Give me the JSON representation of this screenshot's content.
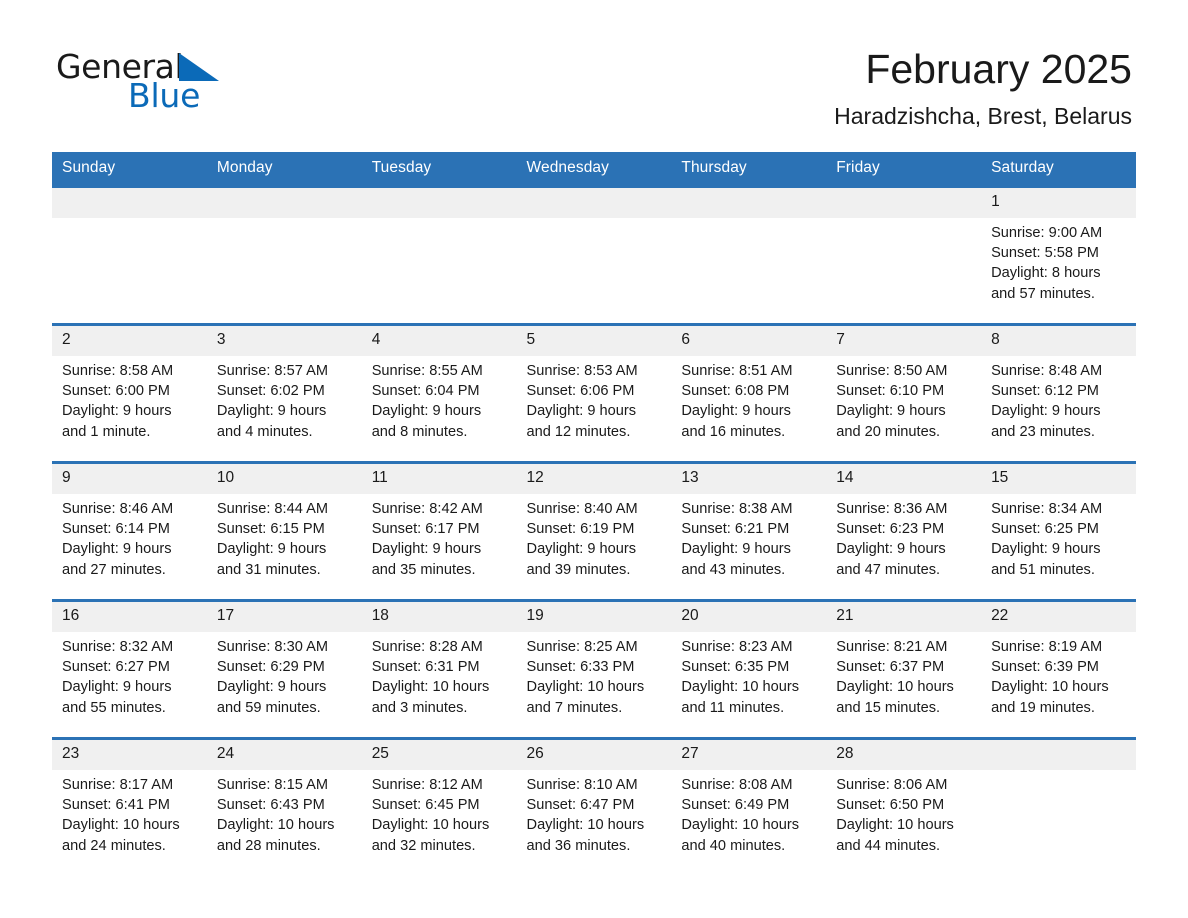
{
  "brand": {
    "name_part1": "General",
    "name_part2": "Blue",
    "accent_color": "#0b6ab8"
  },
  "header": {
    "title": "February 2025",
    "subtitle": "Haradzishcha, Brest, Belarus",
    "header_bg_color": "#2b72b5",
    "daynum_bg_color": "#f0f0f0"
  },
  "weekdays": [
    "Sunday",
    "Monday",
    "Tuesday",
    "Wednesday",
    "Thursday",
    "Friday",
    "Saturday"
  ],
  "labels": {
    "sunrise_prefix": "Sunrise:",
    "sunset_prefix": "Sunset:",
    "daylight_prefix": "Daylight:"
  },
  "weeks": [
    [
      {
        "day": "",
        "line1": "",
        "line2": "",
        "line3": "",
        "line4": "",
        "blank": true
      },
      {
        "day": "",
        "line1": "",
        "line2": "",
        "line3": "",
        "line4": "",
        "blank": true
      },
      {
        "day": "",
        "line1": "",
        "line2": "",
        "line3": "",
        "line4": "",
        "blank": true
      },
      {
        "day": "",
        "line1": "",
        "line2": "",
        "line3": "",
        "line4": "",
        "blank": true
      },
      {
        "day": "",
        "line1": "",
        "line2": "",
        "line3": "",
        "line4": "",
        "blank": true
      },
      {
        "day": "",
        "line1": "",
        "line2": "",
        "line3": "",
        "line4": "",
        "blank": true
      },
      {
        "day": "1",
        "line1": "Sunrise: 9:00 AM",
        "line2": "Sunset: 5:58 PM",
        "line3": "Daylight: 8 hours",
        "line4": "and 57 minutes.",
        "blank": false
      }
    ],
    [
      {
        "day": "2",
        "line1": "Sunrise: 8:58 AM",
        "line2": "Sunset: 6:00 PM",
        "line3": "Daylight: 9 hours",
        "line4": "and 1 minute.",
        "blank": false
      },
      {
        "day": "3",
        "line1": "Sunrise: 8:57 AM",
        "line2": "Sunset: 6:02 PM",
        "line3": "Daylight: 9 hours",
        "line4": "and 4 minutes.",
        "blank": false
      },
      {
        "day": "4",
        "line1": "Sunrise: 8:55 AM",
        "line2": "Sunset: 6:04 PM",
        "line3": "Daylight: 9 hours",
        "line4": "and 8 minutes.",
        "blank": false
      },
      {
        "day": "5",
        "line1": "Sunrise: 8:53 AM",
        "line2": "Sunset: 6:06 PM",
        "line3": "Daylight: 9 hours",
        "line4": "and 12 minutes.",
        "blank": false
      },
      {
        "day": "6",
        "line1": "Sunrise: 8:51 AM",
        "line2": "Sunset: 6:08 PM",
        "line3": "Daylight: 9 hours",
        "line4": "and 16 minutes.",
        "blank": false
      },
      {
        "day": "7",
        "line1": "Sunrise: 8:50 AM",
        "line2": "Sunset: 6:10 PM",
        "line3": "Daylight: 9 hours",
        "line4": "and 20 minutes.",
        "blank": false
      },
      {
        "day": "8",
        "line1": "Sunrise: 8:48 AM",
        "line2": "Sunset: 6:12 PM",
        "line3": "Daylight: 9 hours",
        "line4": "and 23 minutes.",
        "blank": false
      }
    ],
    [
      {
        "day": "9",
        "line1": "Sunrise: 8:46 AM",
        "line2": "Sunset: 6:14 PM",
        "line3": "Daylight: 9 hours",
        "line4": "and 27 minutes.",
        "blank": false
      },
      {
        "day": "10",
        "line1": "Sunrise: 8:44 AM",
        "line2": "Sunset: 6:15 PM",
        "line3": "Daylight: 9 hours",
        "line4": "and 31 minutes.",
        "blank": false
      },
      {
        "day": "11",
        "line1": "Sunrise: 8:42 AM",
        "line2": "Sunset: 6:17 PM",
        "line3": "Daylight: 9 hours",
        "line4": "and 35 minutes.",
        "blank": false
      },
      {
        "day": "12",
        "line1": "Sunrise: 8:40 AM",
        "line2": "Sunset: 6:19 PM",
        "line3": "Daylight: 9 hours",
        "line4": "and 39 minutes.",
        "blank": false
      },
      {
        "day": "13",
        "line1": "Sunrise: 8:38 AM",
        "line2": "Sunset: 6:21 PM",
        "line3": "Daylight: 9 hours",
        "line4": "and 43 minutes.",
        "blank": false
      },
      {
        "day": "14",
        "line1": "Sunrise: 8:36 AM",
        "line2": "Sunset: 6:23 PM",
        "line3": "Daylight: 9 hours",
        "line4": "and 47 minutes.",
        "blank": false
      },
      {
        "day": "15",
        "line1": "Sunrise: 8:34 AM",
        "line2": "Sunset: 6:25 PM",
        "line3": "Daylight: 9 hours",
        "line4": "and 51 minutes.",
        "blank": false
      }
    ],
    [
      {
        "day": "16",
        "line1": "Sunrise: 8:32 AM",
        "line2": "Sunset: 6:27 PM",
        "line3": "Daylight: 9 hours",
        "line4": "and 55 minutes.",
        "blank": false
      },
      {
        "day": "17",
        "line1": "Sunrise: 8:30 AM",
        "line2": "Sunset: 6:29 PM",
        "line3": "Daylight: 9 hours",
        "line4": "and 59 minutes.",
        "blank": false
      },
      {
        "day": "18",
        "line1": "Sunrise: 8:28 AM",
        "line2": "Sunset: 6:31 PM",
        "line3": "Daylight: 10 hours",
        "line4": "and 3 minutes.",
        "blank": false
      },
      {
        "day": "19",
        "line1": "Sunrise: 8:25 AM",
        "line2": "Sunset: 6:33 PM",
        "line3": "Daylight: 10 hours",
        "line4": "and 7 minutes.",
        "blank": false
      },
      {
        "day": "20",
        "line1": "Sunrise: 8:23 AM",
        "line2": "Sunset: 6:35 PM",
        "line3": "Daylight: 10 hours",
        "line4": "and 11 minutes.",
        "blank": false
      },
      {
        "day": "21",
        "line1": "Sunrise: 8:21 AM",
        "line2": "Sunset: 6:37 PM",
        "line3": "Daylight: 10 hours",
        "line4": "and 15 minutes.",
        "blank": false
      },
      {
        "day": "22",
        "line1": "Sunrise: 8:19 AM",
        "line2": "Sunset: 6:39 PM",
        "line3": "Daylight: 10 hours",
        "line4": "and 19 minutes.",
        "blank": false
      }
    ],
    [
      {
        "day": "23",
        "line1": "Sunrise: 8:17 AM",
        "line2": "Sunset: 6:41 PM",
        "line3": "Daylight: 10 hours",
        "line4": "and 24 minutes.",
        "blank": false
      },
      {
        "day": "24",
        "line1": "Sunrise: 8:15 AM",
        "line2": "Sunset: 6:43 PM",
        "line3": "Daylight: 10 hours",
        "line4": "and 28 minutes.",
        "blank": false
      },
      {
        "day": "25",
        "line1": "Sunrise: 8:12 AM",
        "line2": "Sunset: 6:45 PM",
        "line3": "Daylight: 10 hours",
        "line4": "and 32 minutes.",
        "blank": false
      },
      {
        "day": "26",
        "line1": "Sunrise: 8:10 AM",
        "line2": "Sunset: 6:47 PM",
        "line3": "Daylight: 10 hours",
        "line4": "and 36 minutes.",
        "blank": false
      },
      {
        "day": "27",
        "line1": "Sunrise: 8:08 AM",
        "line2": "Sunset: 6:49 PM",
        "line3": "Daylight: 10 hours",
        "line4": "and 40 minutes.",
        "blank": false
      },
      {
        "day": "28",
        "line1": "Sunrise: 8:06 AM",
        "line2": "Sunset: 6:50 PM",
        "line3": "Daylight: 10 hours",
        "line4": "and 44 minutes.",
        "blank": false
      },
      {
        "day": "",
        "line1": "",
        "line2": "",
        "line3": "",
        "line4": "",
        "blank": true
      }
    ]
  ]
}
